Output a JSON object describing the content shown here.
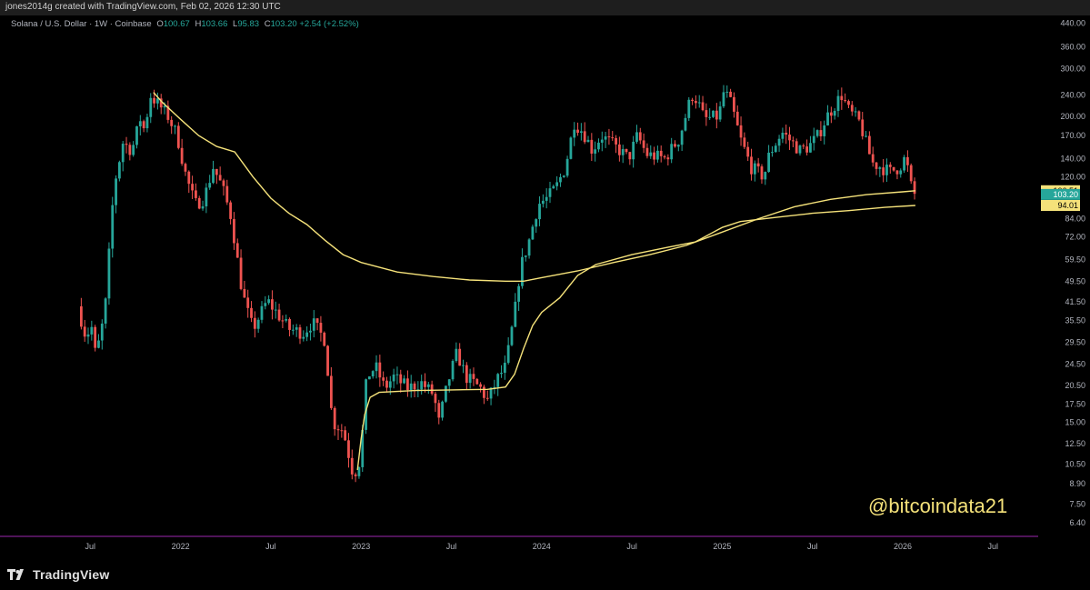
{
  "header": {
    "attribution": "jones2014g created with TradingView.com, Feb 02, 2026 12:30 UTC"
  },
  "legend": {
    "symbol": "Solana / U.S. Dollar · 1W · Coinbase",
    "open_label": "O",
    "open": "100.67",
    "high_label": "H",
    "high": "103.66",
    "low_label": "L",
    "low": "95.83",
    "close_label": "C",
    "close": "103.20",
    "change": "+2.54 (+2.52%)"
  },
  "watermark": "@bitcoindata21",
  "footer": {
    "brand": "TradingView"
  },
  "colors": {
    "up": "#26a69a",
    "down": "#ef5350",
    "ma": "#f5e27a",
    "close_tag": "#26a69a",
    "ma_tag": "#f5e27a",
    "bottom_line": "#9c27b0"
  },
  "chart_data": {
    "type": "candlestick",
    "timeframe": "1W",
    "y_scale": "log",
    "ylim": [
      5.7,
      470
    ],
    "price_ticks": [
      440,
      360,
      300,
      240,
      200,
      170,
      140,
      120,
      84,
      72,
      59.5,
      49.5,
      41.5,
      35.5,
      29.5,
      24.5,
      20.5,
      17.5,
      15,
      12.5,
      10.5,
      8.9,
      7.5,
      6.4
    ],
    "price_tick_labels": [
      "440.00",
      "360.00",
      "300.00",
      "240.00",
      "200.00",
      "170.00",
      "140.00",
      "120.00",
      "84.00",
      "72.00",
      "59.50",
      "49.50",
      "41.50",
      "35.50",
      "29.50",
      "24.50",
      "20.50",
      "17.50",
      "15.00",
      "12.50",
      "10.50",
      "8.90",
      "7.50",
      "6.40"
    ],
    "price_tags": [
      {
        "label": "106.51",
        "value": 106.51,
        "kind": "ma"
      },
      {
        "label": "103.20",
        "value": 103.2,
        "kind": "close"
      },
      {
        "label": "94.01",
        "value": 94.01,
        "kind": "ma"
      }
    ],
    "time_labels": [
      {
        "label": "Jul",
        "t": 2021.5
      },
      {
        "label": "2022",
        "t": 2022.0
      },
      {
        "label": "Jul",
        "t": 2022.5
      },
      {
        "label": "2023",
        "t": 2023.0
      },
      {
        "label": "Jul",
        "t": 2023.5
      },
      {
        "label": "2024",
        "t": 2024.0
      },
      {
        "label": "Jul",
        "t": 2024.5
      },
      {
        "label": "2025",
        "t": 2025.0
      },
      {
        "label": "Jul",
        "t": 2025.5
      },
      {
        "label": "2026",
        "t": 2026.0
      },
      {
        "label": "Jul",
        "t": 2026.5
      }
    ],
    "xlim": [
      2021.0,
      2026.75
    ],
    "price_path": [
      [
        2021.45,
        40
      ],
      [
        2021.5,
        30
      ],
      [
        2021.52,
        36
      ],
      [
        2021.55,
        26
      ],
      [
        2021.6,
        38
      ],
      [
        2021.65,
        110
      ],
      [
        2021.7,
        160
      ],
      [
        2021.75,
        150
      ],
      [
        2021.8,
        200
      ],
      [
        2021.82,
        175
      ],
      [
        2021.85,
        240
      ],
      [
        2021.9,
        220
      ],
      [
        2021.95,
        200
      ],
      [
        2022.0,
        170
      ],
      [
        2022.05,
        120
      ],
      [
        2022.1,
        95
      ],
      [
        2022.15,
        100
      ],
      [
        2022.2,
        130
      ],
      [
        2022.25,
        110
      ],
      [
        2022.3,
        85
      ],
      [
        2022.35,
        50
      ],
      [
        2022.38,
        40
      ],
      [
        2022.42,
        33
      ],
      [
        2022.5,
        42
      ],
      [
        2022.55,
        38
      ],
      [
        2022.62,
        33
      ],
      [
        2022.7,
        32
      ],
      [
        2022.75,
        35
      ],
      [
        2022.82,
        30
      ],
      [
        2022.86,
        15
      ],
      [
        2022.92,
        14
      ],
      [
        2022.97,
        10
      ],
      [
        2023.0,
        9.9
      ],
      [
        2023.02,
        12
      ],
      [
        2023.05,
        22
      ],
      [
        2023.1,
        24
      ],
      [
        2023.15,
        20
      ],
      [
        2023.2,
        22
      ],
      [
        2023.28,
        20
      ],
      [
        2023.35,
        21
      ],
      [
        2023.42,
        19
      ],
      [
        2023.45,
        15
      ],
      [
        2023.5,
        21
      ],
      [
        2023.55,
        27
      ],
      [
        2023.6,
        22
      ],
      [
        2023.68,
        20
      ],
      [
        2023.72,
        18
      ],
      [
        2023.78,
        22
      ],
      [
        2023.82,
        24
      ],
      [
        2023.87,
        38
      ],
      [
        2023.9,
        55
      ],
      [
        2023.95,
        70
      ],
      [
        2024.0,
        95
      ],
      [
        2024.05,
        100
      ],
      [
        2024.1,
        110
      ],
      [
        2024.15,
        130
      ],
      [
        2024.2,
        190
      ],
      [
        2024.25,
        175
      ],
      [
        2024.3,
        150
      ],
      [
        2024.35,
        170
      ],
      [
        2024.45,
        150
      ],
      [
        2024.5,
        140
      ],
      [
        2024.55,
        170
      ],
      [
        2024.6,
        145
      ],
      [
        2024.7,
        140
      ],
      [
        2024.78,
        165
      ],
      [
        2024.85,
        240
      ],
      [
        2024.88,
        230
      ],
      [
        2024.92,
        195
      ],
      [
        2025.0,
        200
      ],
      [
        2025.03,
        250
      ],
      [
        2025.07,
        220
      ],
      [
        2025.12,
        165
      ],
      [
        2025.18,
        130
      ],
      [
        2025.25,
        120
      ],
      [
        2025.28,
        145
      ],
      [
        2025.35,
        175
      ],
      [
        2025.45,
        150
      ],
      [
        2025.5,
        155
      ],
      [
        2025.55,
        170
      ],
      [
        2025.6,
        200
      ],
      [
        2025.68,
        240
      ],
      [
        2025.72,
        210
      ],
      [
        2025.78,
        190
      ],
      [
        2025.85,
        135
      ],
      [
        2025.9,
        130
      ],
      [
        2025.95,
        125
      ],
      [
        2026.0,
        130
      ],
      [
        2026.03,
        140
      ],
      [
        2026.06,
        120
      ],
      [
        2026.07,
        103.2
      ]
    ],
    "series": [
      {
        "name": "",
        "points": [
          [
            2021.85,
            245
          ],
          [
            2021.9,
            225
          ],
          [
            2022.0,
            195
          ],
          [
            2022.1,
            170
          ],
          [
            2022.2,
            155
          ],
          [
            2022.3,
            148
          ],
          [
            2022.4,
            120
          ],
          [
            2022.5,
            100
          ],
          [
            2022.6,
            88
          ],
          [
            2022.7,
            80
          ],
          [
            2022.8,
            70
          ],
          [
            2022.9,
            62
          ],
          [
            2023.0,
            58
          ],
          [
            2023.2,
            53.5
          ],
          [
            2023.4,
            51.5
          ],
          [
            2023.6,
            50
          ],
          [
            2023.8,
            49.5
          ],
          [
            2023.9,
            49.5
          ],
          [
            2024.0,
            51
          ],
          [
            2024.2,
            54
          ],
          [
            2024.4,
            58
          ],
          [
            2024.6,
            62
          ],
          [
            2024.8,
            67
          ],
          [
            2025.0,
            75
          ],
          [
            2025.2,
            84
          ],
          [
            2025.4,
            93
          ],
          [
            2025.6,
            99
          ],
          [
            2025.8,
            103
          ],
          [
            2026.0,
            105.5
          ],
          [
            2026.07,
            106.51
          ]
        ]
      },
      {
        "name": "",
        "points": [
          [
            2022.98,
            10
          ],
          [
            2023.0,
            13
          ],
          [
            2023.02,
            16
          ],
          [
            2023.05,
            18.5
          ],
          [
            2023.1,
            19.3
          ],
          [
            2023.3,
            19.6
          ],
          [
            2023.5,
            19.7
          ],
          [
            2023.7,
            19.8
          ],
          [
            2023.8,
            20.2
          ],
          [
            2023.85,
            22.5
          ],
          [
            2023.9,
            28
          ],
          [
            2023.95,
            34
          ],
          [
            2024.0,
            38
          ],
          [
            2024.1,
            43
          ],
          [
            2024.2,
            52
          ],
          [
            2024.3,
            57
          ],
          [
            2024.5,
            62
          ],
          [
            2024.7,
            66
          ],
          [
            2024.85,
            69
          ],
          [
            2025.0,
            78
          ],
          [
            2025.1,
            82
          ],
          [
            2025.3,
            85
          ],
          [
            2025.5,
            88
          ],
          [
            2025.7,
            90
          ],
          [
            2025.9,
            92.5
          ],
          [
            2026.07,
            94.01
          ]
        ]
      }
    ]
  }
}
